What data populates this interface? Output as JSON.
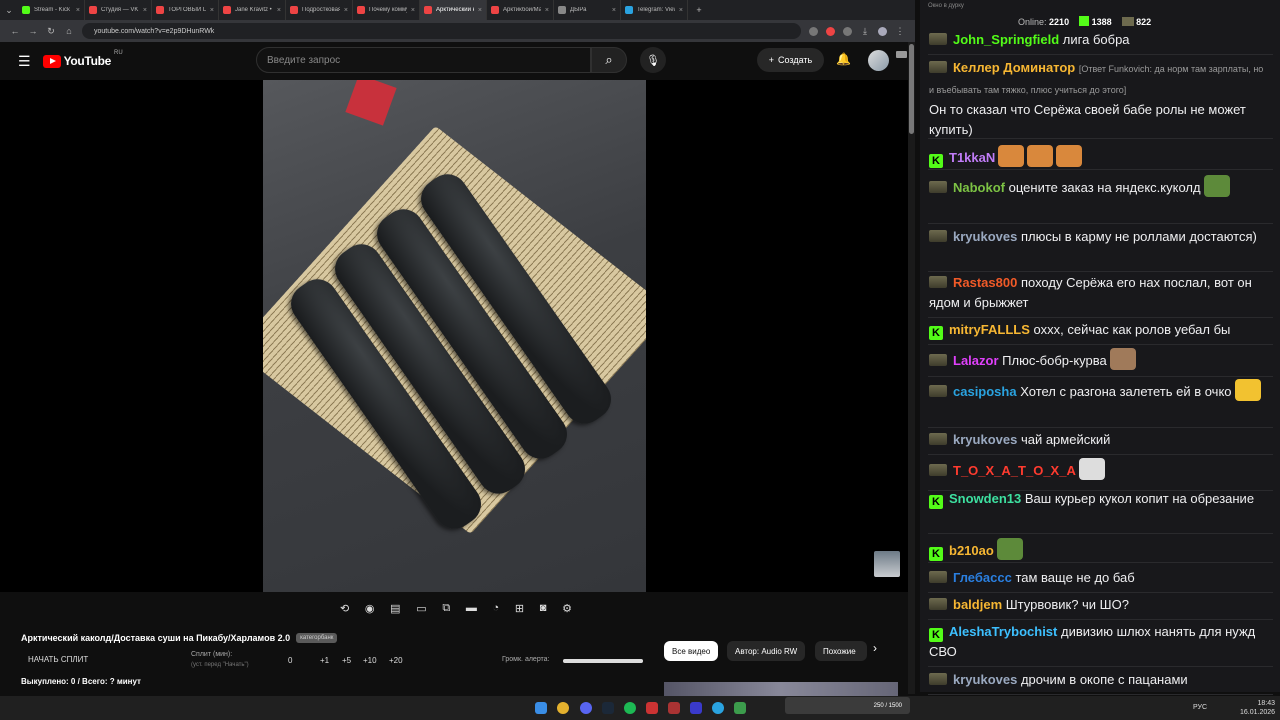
{
  "browser": {
    "tabs": [
      {
        "label": "Stream - Kick D",
        "color": "#53fc18",
        "active": false
      },
      {
        "label": "Студия — VK B",
        "color": "#e44",
        "active": false
      },
      {
        "label": "ТОРГОВЫЙ ЦЕ",
        "color": "#e44",
        "active": false
      },
      {
        "label": "Jane Kravitz • Y",
        "color": "#e44",
        "active": false
      },
      {
        "label": "Подростковая",
        "color": "#e44",
        "active": false
      },
      {
        "label": "Почему комму",
        "color": "#e44",
        "active": false
      },
      {
        "label": "Арктический к",
        "color": "#e44",
        "active": true
      },
      {
        "label": "Арктикбой/Ма",
        "color": "#e44",
        "active": false
      },
      {
        "label": "ДЫРа",
        "color": "#888",
        "active": false
      },
      {
        "label": "Telegram: View",
        "color": "#2aa3e0",
        "active": false
      }
    ],
    "url": "youtube.com/watch?v=e2p9DHunRWk"
  },
  "youtube": {
    "logo_text": "YouTube",
    "region": "RU",
    "search_placeholder": "Введите запрос",
    "create_label": "Создать",
    "video_title": "Арктический каколд/Доставка суши на Пикабу/Харламов 2.0",
    "title_badge": "категорбанк",
    "split_button": "НАЧАТЬ СПЛИТ",
    "split_label": "Сплит (мин):",
    "split_hint": "(уст. перед \"Начать\")",
    "split_value": "0",
    "split_steps": [
      "+1",
      "+5",
      "+10",
      "+20"
    ],
    "volume_label": "Громк. алерта:",
    "volume_level": 1.0,
    "bought": "Выкуплено: 0 / Всего: ? минут",
    "chips": [
      "Все видео",
      "Автор: Audio RW",
      "Похожие"
    ]
  },
  "chat": {
    "window_title": "Окно в дурку",
    "online_label": "Online:",
    "online": "2210",
    "count_a": "1388",
    "count_b": "822",
    "messages": [
      {
        "user": "John_Springfield",
        "color": "#53fc18",
        "text": "лига бобра"
      },
      {
        "user": "Келлер Доминатор",
        "color": "#f7b733",
        "reply": "[Ответ Funkovich: да норм там зарплаты, но и въебывать там тяжко, плюс учиться до этого]",
        "text": "Он то сказал что Серёжа своей бабе ролы не может купить)"
      },
      {
        "user": "T1kkaN",
        "color": "#c07cf7",
        "text": ""
      },
      {
        "user": "Nabokof",
        "color": "#7cc244",
        "text": "оцените заказ на яндекс.куколд"
      },
      {
        "user": "kryukoves",
        "color": "#9aa9c0",
        "text": "плюсы в карму не роллами достаются)"
      },
      {
        "user": "Rastas800",
        "color": "#f05a28",
        "text": "походу Серёжа его нах послал, вот он ядом и брыжжет"
      },
      {
        "user": "mitryFALLLS",
        "color": "#f7b733",
        "text": "охxx, сейчас как ролов уебал бы"
      },
      {
        "user": "Lalazor",
        "color": "#e040fb",
        "text": "Плюс-бобр-курва"
      },
      {
        "user": "casiposha",
        "color": "#2aa3e0",
        "text": "Хотел с разгона залететь ей в очко"
      },
      {
        "user": "kryukoves",
        "color": "#9aa9c0",
        "text": "чай армейский"
      },
      {
        "user": "T_O_X_A_T_O_X_A",
        "color": "#ff3b2f",
        "text": ""
      },
      {
        "user": "Snowden13",
        "color": "#3de0a0",
        "text": "Ваш курьер кукол копит на обрезание"
      },
      {
        "user": "b210ao",
        "color": "#f7b733",
        "text": ""
      },
      {
        "user": "Глебассс",
        "color": "#2a7fe0",
        "text": "там ваще не до баб"
      },
      {
        "user": "baldjem",
        "color": "#f7b733",
        "text": "Штурвовик? чи ШО?"
      },
      {
        "user": "AleshaTrybochist",
        "color": "#3dc0ff",
        "text": "дивизию шлюх нанять для нужд СВО"
      },
      {
        "user": "kryukoves",
        "color": "#9aa9c0",
        "text": "дрочим в окопе с пацанами"
      }
    ]
  },
  "taskbar": {
    "streamer_badge": "250 / 1500",
    "lang": "РУС",
    "time": "18:43",
    "date": "16.01.2026"
  }
}
